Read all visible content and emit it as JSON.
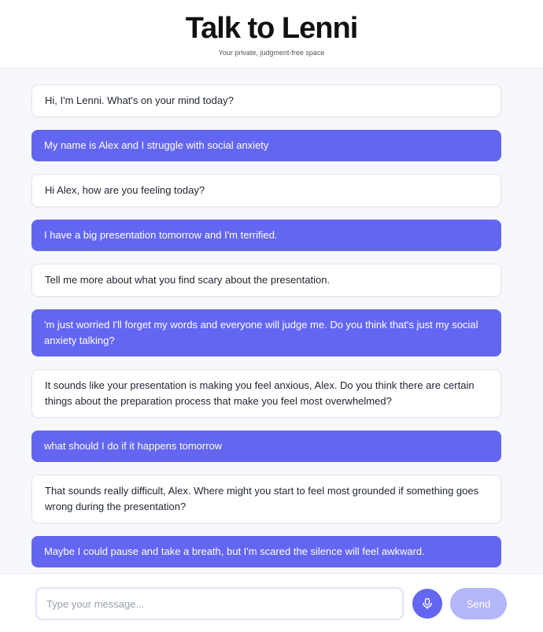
{
  "header": {
    "title": "Talk to Lenni",
    "subtitle": "Your private, judgment-free space"
  },
  "messages": [
    {
      "role": "bot",
      "text": "Hi, I'm Lenni. What's on your mind today?"
    },
    {
      "role": "user",
      "text": "My name is Alex and I struggle with social anxiety"
    },
    {
      "role": "bot",
      "text": "Hi Alex, how are you feeling today?"
    },
    {
      "role": "user",
      "text": "I have a big presentation tomorrow and I'm terrified."
    },
    {
      "role": "bot",
      "text": "Tell me more about what you find scary about the presentation."
    },
    {
      "role": "user",
      "text": "'m just worried I'll forget my words and everyone will judge me. Do you think that's just my social anxiety talking?"
    },
    {
      "role": "bot",
      "text": "It sounds like your presentation is making you feel anxious, Alex. Do you think there are certain things about the preparation process that make you feel most overwhelmed?"
    },
    {
      "role": "user",
      "text": "what should I do if it happens tomorrow"
    },
    {
      "role": "bot",
      "text": "That sounds really difficult, Alex. Where might you start to feel most grounded if something goes wrong during the presentation?"
    },
    {
      "role": "user",
      "text": "Maybe I could pause and take a breath, but I'm scared the silence will feel awkward."
    }
  ],
  "composer": {
    "placeholder": "Type your message...",
    "value": "",
    "mic_icon": "microphone-icon",
    "send_label": "Send"
  },
  "colors": {
    "accent": "#6366f1",
    "send_disabled": "#b3b6f7",
    "bot_bubble": "#ffffff",
    "background": "#f7f8fb"
  }
}
